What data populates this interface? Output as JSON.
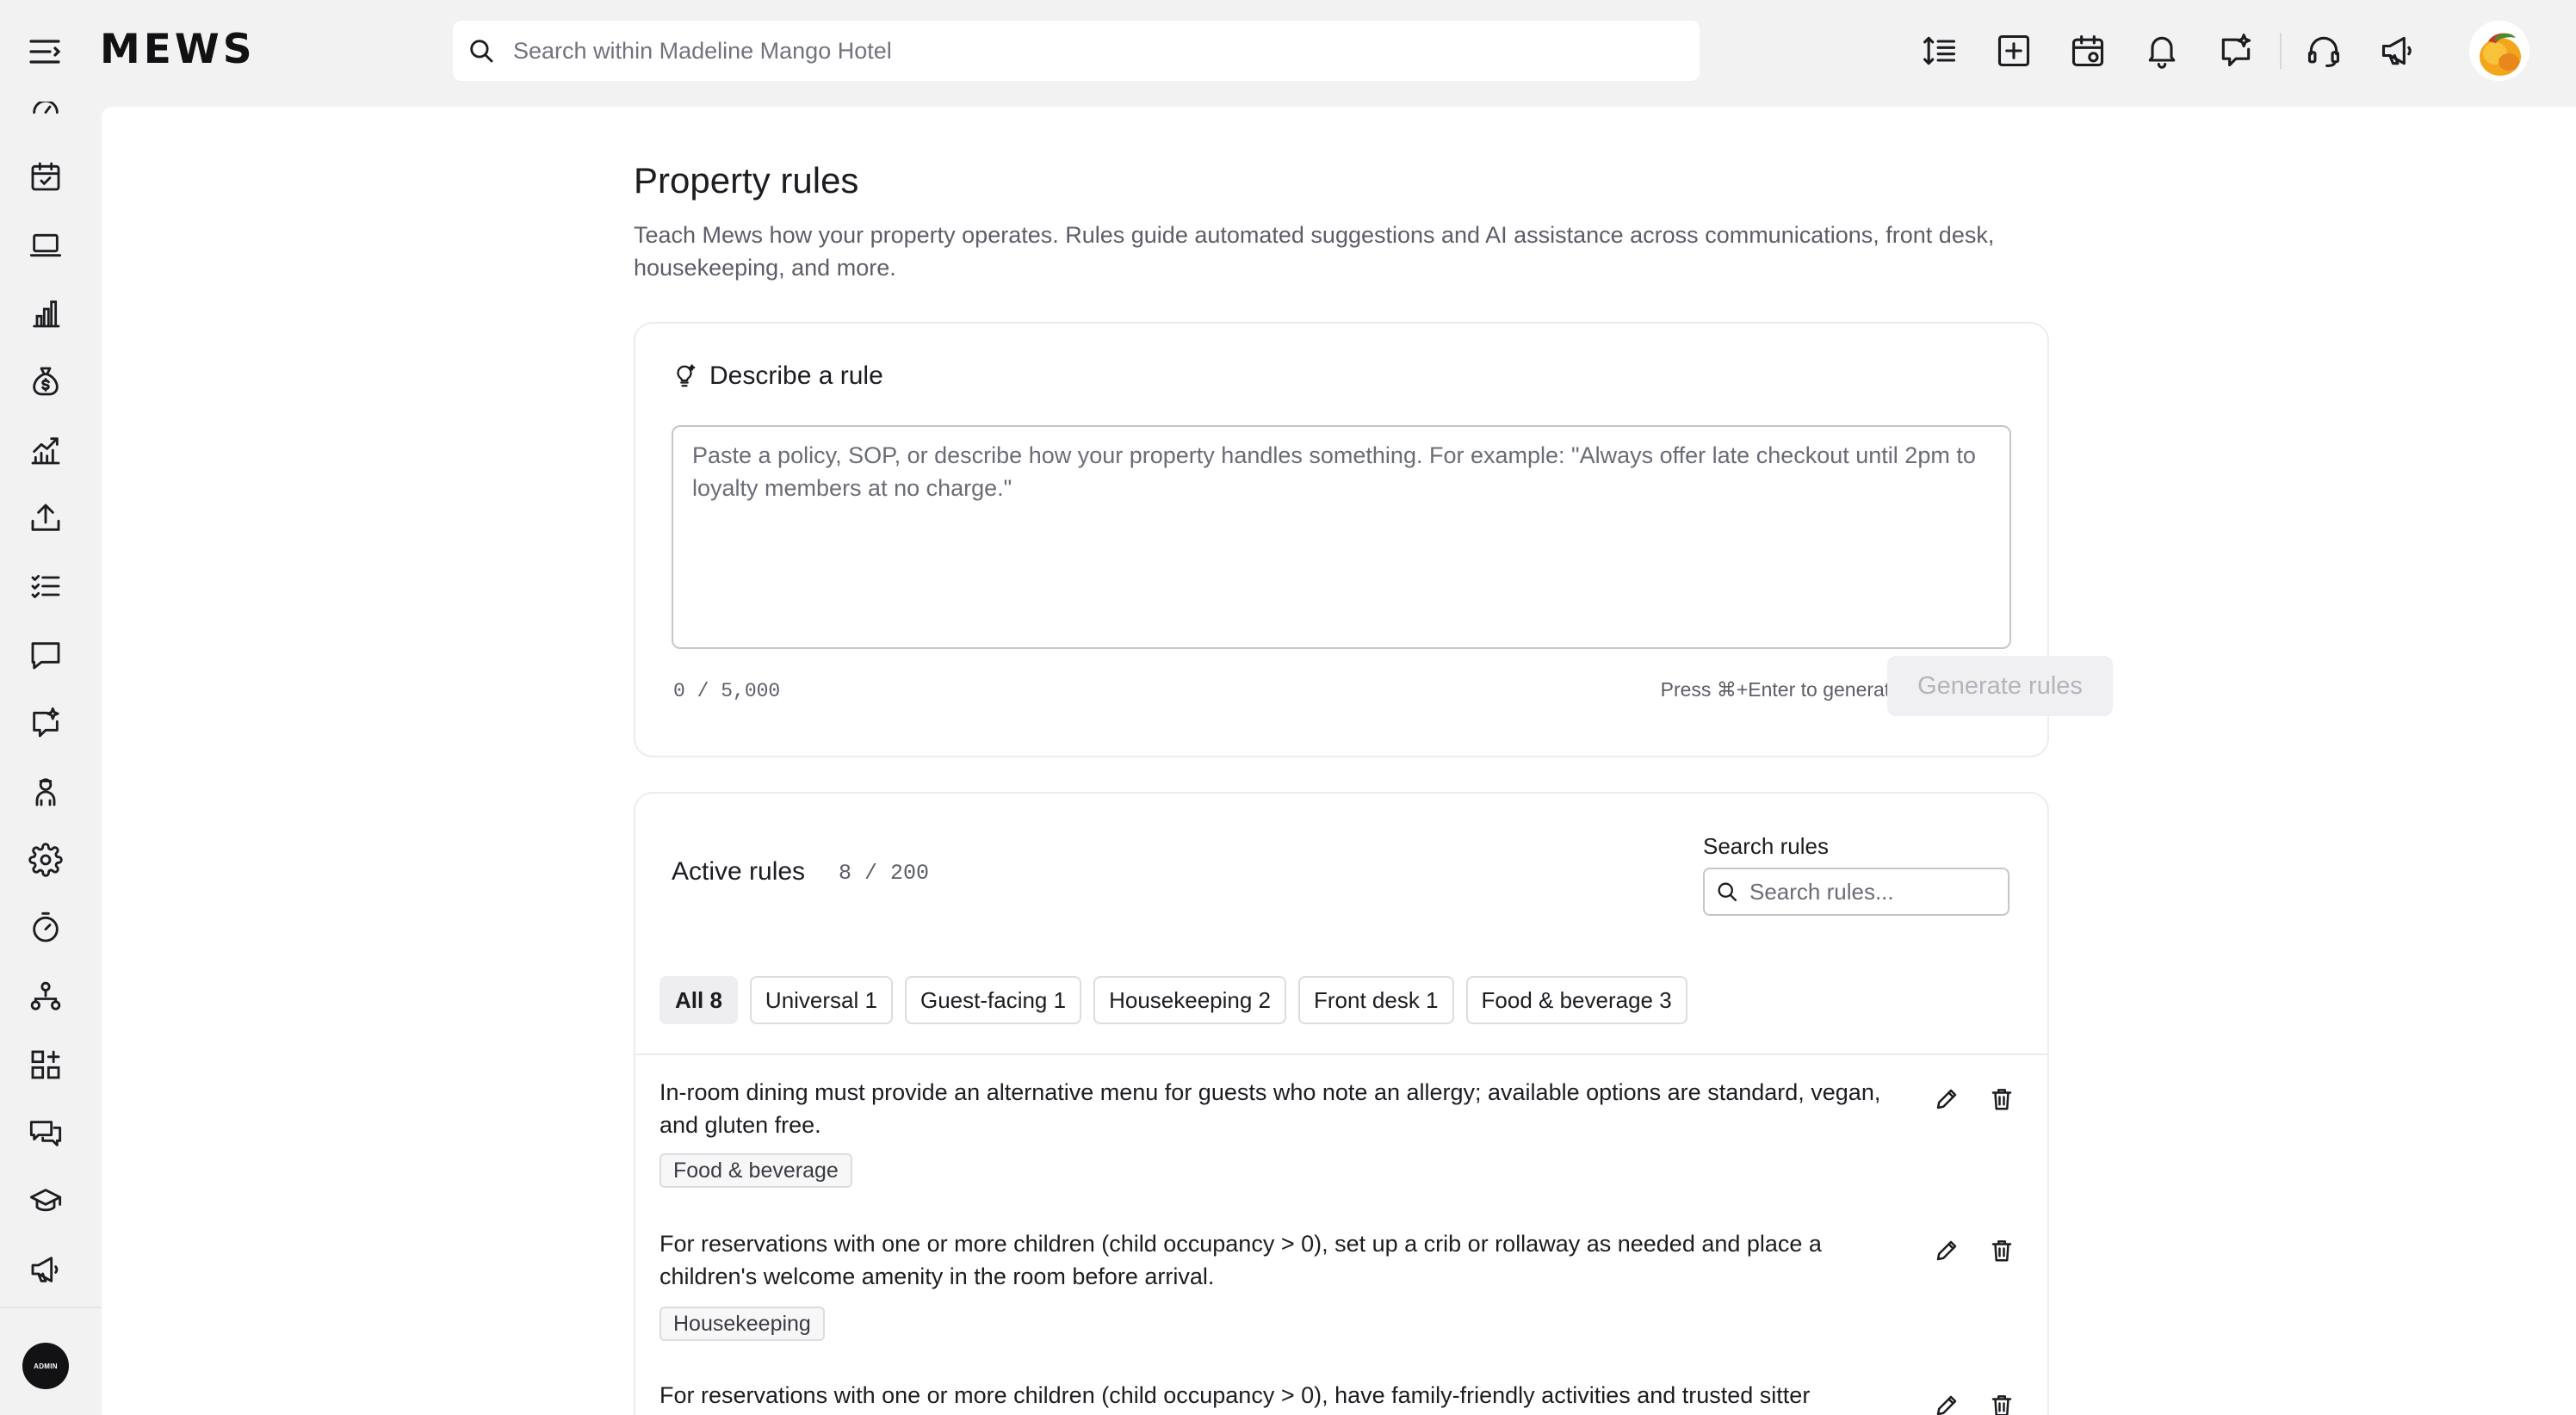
{
  "app": {
    "brand": "MEWS",
    "search_placeholder": "Search within Madeline Mango Hotel"
  },
  "topbar_icons": [
    "sort-lines-icon",
    "add-square-icon",
    "calendar-view-icon",
    "bell-icon",
    "ai-chat-icon",
    "headset-icon",
    "megaphone-icon"
  ],
  "rail_icons": [
    "dashboard-icon",
    "calendar-icon",
    "laptop-icon",
    "bar-chart-icon",
    "money-bag-icon",
    "trend-chart-icon",
    "upload-icon",
    "checklist-icon",
    "chat-bubble-icon",
    "ai-chat-icon",
    "housekeeper-icon",
    "gear-icon",
    "timer-icon",
    "org-chart-icon",
    "apps-icon",
    "conversations-icon",
    "graduation-cap-icon",
    "megaphone-icon"
  ],
  "admin_badge": "ADMIN",
  "page": {
    "title": "Property rules",
    "description": "Teach Mews how your property operates. Rules guide automated suggestions and AI assistance across communications, front desk, housekeeping, and more."
  },
  "describe": {
    "heading": "Describe a rule",
    "placeholder": "Paste a policy, SOP, or describe how your property handles something. For example: \"Always offer late checkout until 2pm to loyalty members at no charge.\"",
    "char_count": "0 / 5,000",
    "shortcut_hint": "Press ⌘+Enter to generate",
    "generate_label": "Generate rules"
  },
  "active": {
    "title": "Active rules",
    "count": "8 / 200",
    "search_label": "Search rules",
    "search_placeholder": "Search rules...",
    "filters": [
      {
        "label": "All 8",
        "selected": true
      },
      {
        "label": "Universal 1",
        "selected": false
      },
      {
        "label": "Guest-facing 1",
        "selected": false
      },
      {
        "label": "Housekeeping 2",
        "selected": false
      },
      {
        "label": "Front desk 1",
        "selected": false
      },
      {
        "label": "Food & beverage 3",
        "selected": false
      }
    ],
    "rules": [
      {
        "text": "In-room dining must provide an alternative menu for guests who note an allergy; available options are standard, vegan, and gluten free.",
        "tag": "Food & beverage"
      },
      {
        "text": "For reservations with one or more children (child occupancy > 0), set up a crib or rollaway as needed and place a children's welcome amenity in the room before arrival.",
        "tag": "Housekeeping"
      },
      {
        "text": "For reservations with one or more children (child occupancy > 0), have family-friendly activities and trusted sitter",
        "tag": ""
      }
    ]
  },
  "colors": {
    "background": "#f2f2f3",
    "surface": "#ffffff",
    "text": "#1c1d21",
    "muted_text": "#5c5e68",
    "border": "#c5c6cc",
    "disabled_button": "#f0f0f3",
    "disabled_button_text": "#b3b5bc"
  }
}
